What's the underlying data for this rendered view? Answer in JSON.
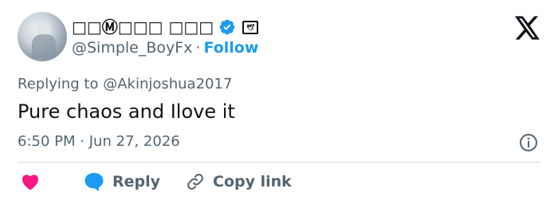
{
  "tweet": {
    "author": {
      "display_name": "□□Ⓜ□□□ □□□",
      "handle": "@Simple_BoyFx",
      "separator": "·",
      "follow_label": "Follow",
      "badge_glyph": "🕊"
    },
    "replying_prefix": "Replying to ",
    "replying_to": "@Akinjoshua2017",
    "text": "Pure chaos and Ilove it",
    "time": "6:50 PM",
    "date_separator": "·",
    "date": "Jun 27, 2026",
    "actions": {
      "reply_label": "Reply",
      "copy_link_label": "Copy link"
    }
  },
  "colors": {
    "accent": "#1d9bf0",
    "heart": "#f91880",
    "muted": "#536471",
    "text": "#0f1419",
    "divider": "#cfd9de"
  },
  "icons": [
    "x-logo-icon",
    "verified-badge-icon",
    "affiliate-badge-icon",
    "info-icon",
    "heart-icon",
    "reply-bubble-icon",
    "link-icon"
  ]
}
